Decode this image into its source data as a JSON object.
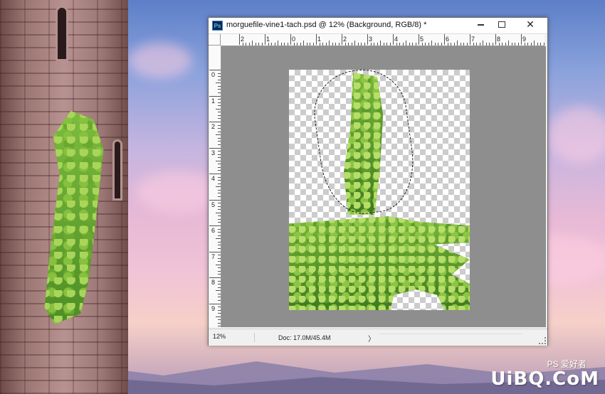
{
  "window": {
    "title": "morguefile-vine1-tach.psd @ 12% (Background, RGB/8) *",
    "app_icon_text": "Ps",
    "minimize_icon": "minimize-icon",
    "maximize_icon": "maximize-icon",
    "close_label": "✕"
  },
  "rulers": {
    "horizontal_labels": [
      "2",
      "1",
      "0",
      "1",
      "2",
      "3",
      "4",
      "5",
      "6",
      "7",
      "8",
      "9"
    ],
    "vertical_labels": [
      "0",
      "1",
      "2",
      "3",
      "4",
      "5",
      "6",
      "7",
      "8",
      "9"
    ]
  },
  "status": {
    "zoom": "12%",
    "doc_info": "Doc: 17.0M/45.4M",
    "arrow": "〉"
  },
  "watermark": {
    "text": "UiBQ.CoM",
    "sub": "PS 爱好者"
  },
  "colors": {
    "canvas_background": "#8e8e8e",
    "window_frame": "#f0f0f0"
  }
}
